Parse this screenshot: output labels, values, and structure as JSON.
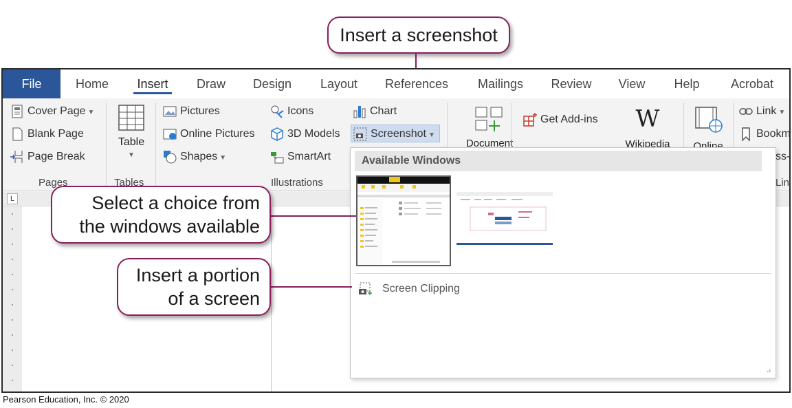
{
  "tabs": [
    "File",
    "Home",
    "Insert",
    "Draw",
    "Design",
    "Layout",
    "References",
    "Mailings",
    "Review",
    "View",
    "Help",
    "Acrobat"
  ],
  "ribbon": {
    "pages": {
      "cover_page": "Cover Page",
      "blank_page": "Blank Page",
      "page_break": "Page Break",
      "label": "Pages"
    },
    "tables": {
      "table": "Table",
      "label": "Tables"
    },
    "illustrations": {
      "pictures": "Pictures",
      "online_pictures": "Online Pictures",
      "shapes": "Shapes",
      "icons": "Icons",
      "models_3d": "3D Models",
      "smartart": "SmartArt",
      "chart": "Chart",
      "screenshot": "Screenshot",
      "label": "Illustrations"
    },
    "document": "Document",
    "get_addins": "Get Add-ins",
    "wikipedia": "Wikipedia",
    "online": "Online",
    "link": "Link",
    "bookmark": "Bookm",
    "cross_ref": "ss-",
    "links_label": "Lin"
  },
  "dropdown": {
    "header": "Available Windows",
    "screen_clipping": "Screen Clipping"
  },
  "callouts": {
    "insert_screenshot": "Insert a screenshot",
    "select_choice_line1": "Select a choice from",
    "select_choice_line2": "the windows available",
    "insert_portion_line1": "Insert a portion",
    "insert_portion_line2": "of a screen"
  },
  "credit": "Pearson Education, Inc. © 2020",
  "colors": {
    "file_tab": "#2b579a",
    "callout_border": "#8b1d5b"
  }
}
